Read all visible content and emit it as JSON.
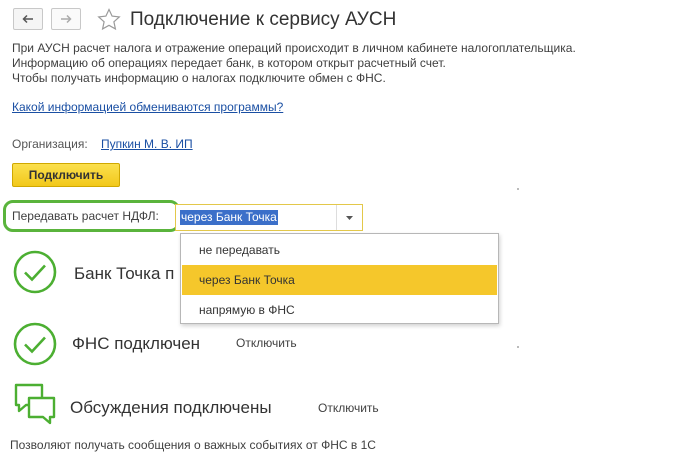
{
  "header": {
    "title": "Подключение к сервису АУСН",
    "back_icon": "arrow-left-icon",
    "forward_icon": "arrow-right-icon",
    "favorite_icon": "star-icon"
  },
  "info": {
    "line1": "При АУСН расчет налога и отражение операций происходит в личном кабинете налогоплательщика.",
    "line2": "Информацию об операциях передает банк, в котором открыт расчетный счет.",
    "line3": "Чтобы получать информацию о налогах подключите обмен с ФНС.",
    "help_link": "Какой информацией обмениваются программы?"
  },
  "organization": {
    "label": "Организация:",
    "value": "Пупкин М. В. ИП"
  },
  "connect_button": "Подключить",
  "ndfl": {
    "label": "Передавать расчет НДФЛ:",
    "selected": "через Банк Точка",
    "options": [
      "не передавать",
      "через Банк Точка",
      "напрямую в ФНС"
    ],
    "selected_index": 1
  },
  "services": {
    "bank": {
      "title": "Банк Точка п"
    },
    "fns": {
      "title": "ФНС подключен",
      "action": "Отключить"
    },
    "discussions": {
      "title": "Обсуждения подключены",
      "action": "Отключить"
    }
  },
  "footer_text": "Позволяют получать сообщения о важных событиях от ФНС в 1С",
  "colors": {
    "accent_yellow": "#f5c72b",
    "check_green": "#4caf32",
    "link_blue": "#1a4fa3",
    "selection_blue": "#3b6fc9"
  }
}
